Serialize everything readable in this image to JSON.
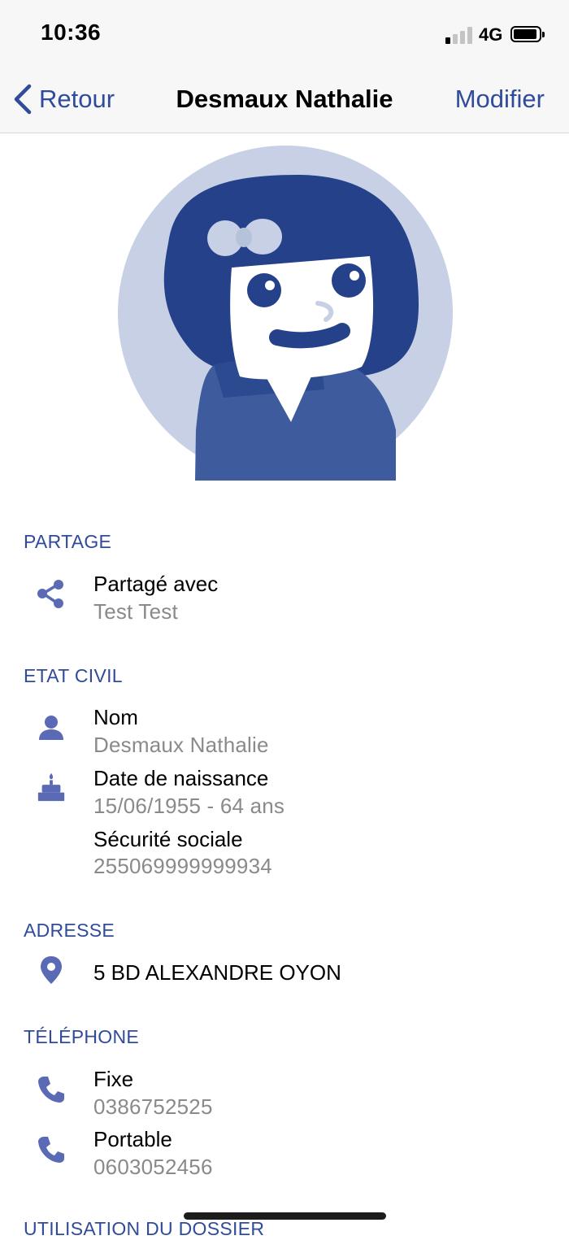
{
  "status_bar": {
    "time": "10:36",
    "network": "4G"
  },
  "nav": {
    "back_label": "Retour",
    "title": "Desmaux Nathalie",
    "edit_label": "Modifier"
  },
  "colors": {
    "accent": "#2f4b9a",
    "icon": "#5b6ab5",
    "avatar_bg": "#c7d0e4",
    "avatar_dark": "#24418a",
    "secondary_text": "#8a8a8a"
  },
  "sections": {
    "partage": {
      "title": "PARTAGE",
      "shared": {
        "icon": "share-icon",
        "label": "Partagé avec",
        "value": "Test Test"
      }
    },
    "etat_civil": {
      "title": "ETAT CIVIL",
      "nom": {
        "icon": "person-icon",
        "label": "Nom",
        "value": "Desmaux Nathalie"
      },
      "naissance": {
        "icon": "birthday-cake-icon",
        "label": "Date de naissance",
        "value": "15/06/1955 - 64 ans"
      },
      "secu": {
        "label": "Sécurité sociale",
        "value": "255069999999934"
      }
    },
    "adresse": {
      "title": "ADRESSE",
      "line": {
        "icon": "location-pin-icon",
        "value": "5 BD ALEXANDRE OYON"
      }
    },
    "telephone": {
      "title": "TÉLÉPHONE",
      "fixe": {
        "icon": "phone-icon",
        "label": "Fixe",
        "value": "0386752525"
      },
      "portable": {
        "icon": "phone-icon",
        "label": "Portable",
        "value": "0603052456"
      }
    },
    "utilisation": {
      "title": "UTILISATION DU DOSSIER"
    }
  }
}
